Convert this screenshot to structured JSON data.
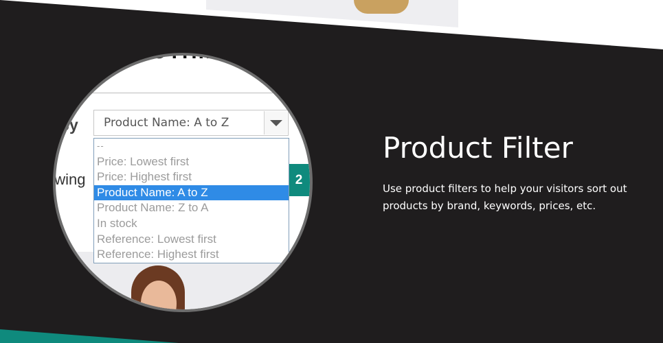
{
  "feature": {
    "title": "Product Filter",
    "description": "Use product filters to help your visitors sort out products by brand, keywords, prices, etc."
  },
  "zoom": {
    "heading_fragment": "LOTHIN",
    "sort_label": "by",
    "selected_value": "Product Name: A to Z",
    "options": [
      "--",
      "Price: Lowest first",
      "Price: Highest first",
      "Product Name: A to Z",
      "Product Name: Z to A",
      "In stock",
      "Reference: Lowest first",
      "Reference: Highest first"
    ],
    "selected_index": 3,
    "showing_text": "owing",
    "page_number": "2"
  },
  "colors": {
    "background": "#1f1d1e",
    "accent": "#0f8a7d",
    "selection": "#2f8be6"
  }
}
